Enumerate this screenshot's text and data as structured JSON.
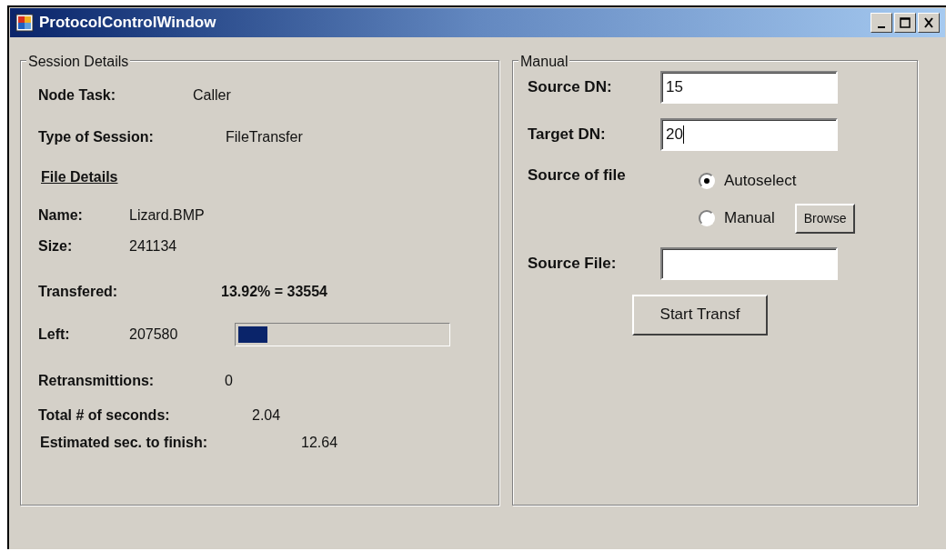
{
  "window": {
    "title": "ProtocolControlWindow"
  },
  "session": {
    "title": "Session Details",
    "node_task": {
      "label": "Node Task:",
      "value": "Caller"
    },
    "session_type": {
      "label": "Type of Session:",
      "value": "FileTransfer"
    },
    "file_details": {
      "heading": "File Details",
      "name": {
        "label": "Name:",
        "value": "Lizard.BMP"
      },
      "size": {
        "label": "Size:",
        "value": "241134"
      },
      "transfered": {
        "label": "Transfered:",
        "value": "13.92% = 33554"
      },
      "left": {
        "label": "Left:",
        "value": "207580",
        "level": 0.14
      }
    },
    "retransmittions": {
      "label": "Retransmittions:",
      "value": "0"
    },
    "total_seconds": {
      "label": "Total # of seconds:",
      "value": "2.04"
    },
    "estimated": {
      "label": "Estimated sec. to finish:",
      "value": "12.64"
    }
  },
  "manual": {
    "title": "Manual",
    "source_dn": {
      "label": "Source DN:",
      "value": "15"
    },
    "target_dn": {
      "label": "Target DN:",
      "value": "20"
    },
    "source_of_file": {
      "label": "Source of file",
      "options": [
        {
          "label": "Autoselect",
          "selected": true
        },
        {
          "label": "Manual",
          "selected": false
        }
      ]
    },
    "browse_button": "Browse",
    "source_file": {
      "label": "Source File:"
    },
    "start_button": "Start Transf"
  }
}
